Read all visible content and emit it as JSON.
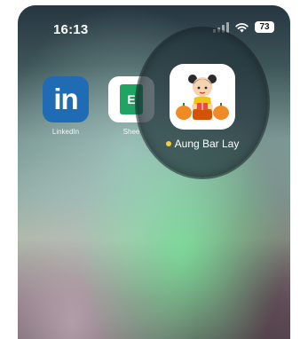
{
  "status_bar": {
    "time": "16:13",
    "battery": "73"
  },
  "apps": {
    "linkedin": {
      "label": "LinkedIn",
      "glyph": "in",
      "color": "#1f6cb4"
    },
    "sheets": {
      "label": "Shee",
      "glyph": "E",
      "color": "#1fa463"
    },
    "aung_bar_lay": {
      "label": "Aung Bar Lay",
      "badge_color": "#f4d03f"
    }
  }
}
